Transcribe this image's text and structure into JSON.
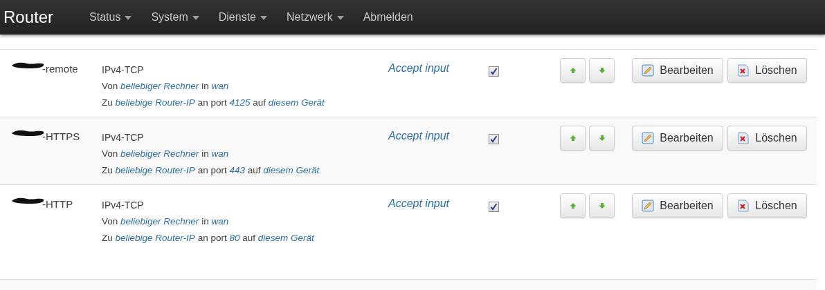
{
  "navbar": {
    "brand": "Router",
    "menu": [
      {
        "label": "Status",
        "dropdown": true
      },
      {
        "label": "System",
        "dropdown": true
      },
      {
        "label": "Dienste",
        "dropdown": true
      },
      {
        "label": "Netzwerk",
        "dropdown": true
      },
      {
        "label": "Abmelden",
        "dropdown": false
      }
    ]
  },
  "rules": [
    {
      "name": "-remote",
      "redacted": true,
      "protocol": "IPv4-TCP",
      "lines": [
        [
          {
            "text": "Von",
            "link": false
          },
          {
            "text": "beliebiger Rechner",
            "link": true
          },
          {
            "text": "in",
            "link": false
          },
          {
            "text": "wan",
            "link": true
          }
        ],
        [
          {
            "text": "Zu",
            "link": false
          },
          {
            "text": "beliebige Router-IP",
            "link": true
          },
          {
            "text": "an port",
            "link": false
          },
          {
            "text": "4125",
            "link": true
          },
          {
            "text": "auf",
            "link": false
          },
          {
            "text": "diesem Gerät",
            "link": true
          }
        ]
      ],
      "action": "Accept input",
      "enabled": true,
      "edit": "Bearbeiten",
      "delete": "Löschen"
    },
    {
      "name": "-HTTPS",
      "redacted": true,
      "protocol": "IPv4-TCP",
      "lines": [
        [
          {
            "text": "Von",
            "link": false
          },
          {
            "text": "beliebiger Rechner",
            "link": true
          },
          {
            "text": "in",
            "link": false
          },
          {
            "text": "wan",
            "link": true
          }
        ],
        [
          {
            "text": "Zu",
            "link": false
          },
          {
            "text": "beliebige Router-IP",
            "link": true
          },
          {
            "text": "an port",
            "link": false
          },
          {
            "text": "443",
            "link": true
          },
          {
            "text": "auf",
            "link": false
          },
          {
            "text": "diesem Gerät",
            "link": true
          }
        ]
      ],
      "action": "Accept input",
      "enabled": true,
      "edit": "Bearbeiten",
      "delete": "Löschen"
    },
    {
      "name": "-HTTP",
      "redacted": true,
      "protocol": "IPv4-TCP",
      "lines": [
        [
          {
            "text": "Von",
            "link": false
          },
          {
            "text": "beliebiger Rechner",
            "link": true
          },
          {
            "text": "in",
            "link": false
          },
          {
            "text": "wan",
            "link": true
          }
        ],
        [
          {
            "text": "Zu",
            "link": false
          },
          {
            "text": "beliebige Router-IP",
            "link": true
          },
          {
            "text": "an port",
            "link": false
          },
          {
            "text": "80",
            "link": true
          },
          {
            "text": "auf",
            "link": false
          },
          {
            "text": "diesem Gerät",
            "link": true
          }
        ]
      ],
      "action": "Accept input",
      "enabled": true,
      "edit": "Bearbeiten",
      "delete": "Löschen"
    }
  ]
}
